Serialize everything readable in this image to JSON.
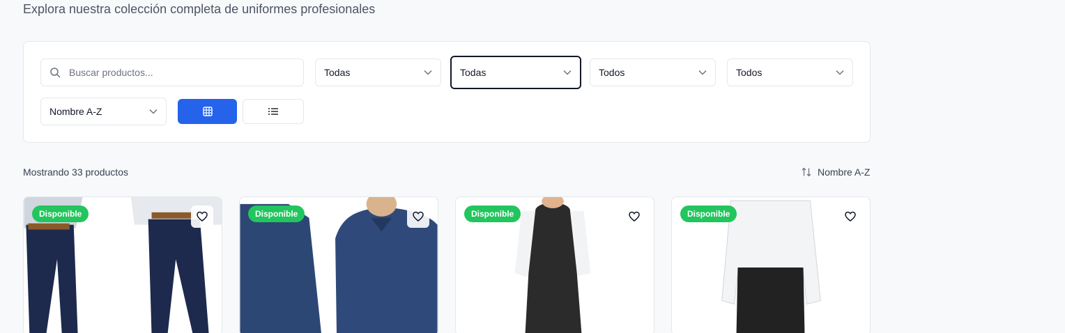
{
  "header": {
    "subtitle": "Explora nuestra colección completa de uniformes profesionales"
  },
  "filters": {
    "search_placeholder": "Buscar productos...",
    "selects": [
      "Todas",
      "Todas",
      "Todos",
      "Todos"
    ],
    "sort_select": "Nombre A-Z",
    "view_modes": [
      "grid-icon",
      "list-icon"
    ],
    "active_view": "grid",
    "accent_color": "#2563eb"
  },
  "results": {
    "count_label": "Mostrando 33 productos",
    "sort_label": "Nombre A-Z"
  },
  "products": [
    {
      "badge": "Disponible",
      "image": "jeans"
    },
    {
      "badge": "Disponible",
      "image": "polo-long-sleeve"
    },
    {
      "badge": "Disponible",
      "image": "bib-apron"
    },
    {
      "badge": "Disponible",
      "image": "waist-apron"
    }
  ],
  "badge_color": "#22c55e"
}
